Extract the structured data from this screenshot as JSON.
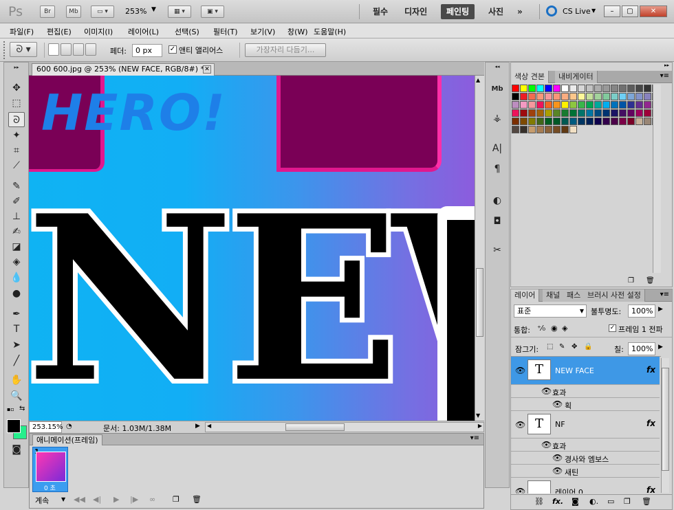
{
  "app": {
    "logo": "Ps",
    "bridge": "Br",
    "minibridge": "Mb",
    "zoom": "253%",
    "workspaces": [
      "필수",
      "디자인",
      "페인팅",
      "사진"
    ],
    "active_workspace": "페인팅",
    "more": "»",
    "cslive": "CS Live"
  },
  "menu": [
    "파일(F)",
    "편집(E)",
    "이미지(I)",
    "레이어(L)",
    "선택(S)",
    "필터(T)",
    "보기(V)",
    "창(W)",
    "도움말(H)"
  ],
  "options": {
    "feather_label": "페더:",
    "feather_value": "0 px",
    "antialias_label": "앤티 앨리어스",
    "refine_button": "가장자리 다듬기..."
  },
  "document": {
    "tab_title": "600 600.jpg @ 253% (NEW FACE, RGB/8#) *",
    "canvas_hero": "HERO!",
    "canvas_text": "NEW"
  },
  "status": {
    "zoom": "253.15%",
    "doc": "문서: 1.03M/1.38M"
  },
  "animation": {
    "title": "애니메이션(프레임)",
    "frame_number": "1",
    "frame_time": "0 초",
    "loop": "계속"
  },
  "swatches": {
    "tabs": [
      "색상 견본",
      "내비게이터"
    ],
    "colors": [
      "#ff0000",
      "#ffff00",
      "#00ff00",
      "#00ffff",
      "#0000ff",
      "#ff00ff",
      "#ffffff",
      "#ebebeb",
      "#d6d6d6",
      "#c2c2c2",
      "#adadad",
      "#999999",
      "#858585",
      "#707070",
      "#5c5c5c",
      "#474747",
      "#333333",
      "#1f1f1f",
      "#000000",
      "#ed1c24",
      "#f26c4f",
      "#f7977a",
      "#f5989d",
      "#f69679",
      "#f9ad81",
      "#fdc68a",
      "#fff79a",
      "#c4df9b",
      "#a3d39c",
      "#82ca9d",
      "#7bcdc8",
      "#6ecff6",
      "#7ea7d8",
      "#8493ca",
      "#8882be",
      "#a187be",
      "#bc8dbf",
      "#f49ac2",
      "#f6989d",
      "#ed145b",
      "#f26522",
      "#f7941d",
      "#fff200",
      "#8dc63f",
      "#39b54a",
      "#00a651",
      "#00a99d",
      "#00aeef",
      "#0072bc",
      "#0054a6",
      "#2e3192",
      "#662d91",
      "#92278f",
      "#ec008c",
      "#ed145b",
      "#9e0b0f",
      "#a0410d",
      "#a36209",
      "#aba000",
      "#598527",
      "#197b30",
      "#007236",
      "#00746b",
      "#0076a3",
      "#004b80",
      "#003471",
      "#1b1464",
      "#440e62",
      "#630460",
      "#9e005d",
      "#9e0039",
      "#790000",
      "#7b2e00",
      "#7d4900",
      "#827b00",
      "#406618",
      "#005e20",
      "#005826",
      "#005952",
      "#005b7f",
      "#003663",
      "#002157",
      "#0d004c",
      "#32004b",
      "#4b0049",
      "#7b0046",
      "#7a0026",
      "#c7b299",
      "#998675",
      "#736357",
      "#534741",
      "#37302a",
      "#c69c6d",
      "#a67c52",
      "#8c6239",
      "#754c24",
      "#603913",
      "#f1e0c4"
    ]
  },
  "layers": {
    "tabs": [
      "레이어",
      "채널",
      "패스",
      "브러시 사전 설정"
    ],
    "blend_mode": "표준",
    "opacity_label": "불투명도:",
    "opacity": "100%",
    "unify_label": "통합:",
    "propagate_label": "프레임 1 전파",
    "lock_label": "잠그기:",
    "fill_label": "칠:",
    "fill": "100%",
    "rows": [
      {
        "name": "NEW FACE",
        "type": "text"
      },
      {
        "name": "효과",
        "type": "effects"
      },
      {
        "name": "획",
        "type": "effect"
      },
      {
        "name": "NF",
        "type": "text"
      },
      {
        "name": "효과",
        "type": "effects"
      },
      {
        "name": "경사와 엠보스",
        "type": "effect"
      },
      {
        "name": "새틴",
        "type": "effect"
      },
      {
        "name": "레이어 0",
        "type": "image"
      }
    ],
    "fx": "fx"
  }
}
